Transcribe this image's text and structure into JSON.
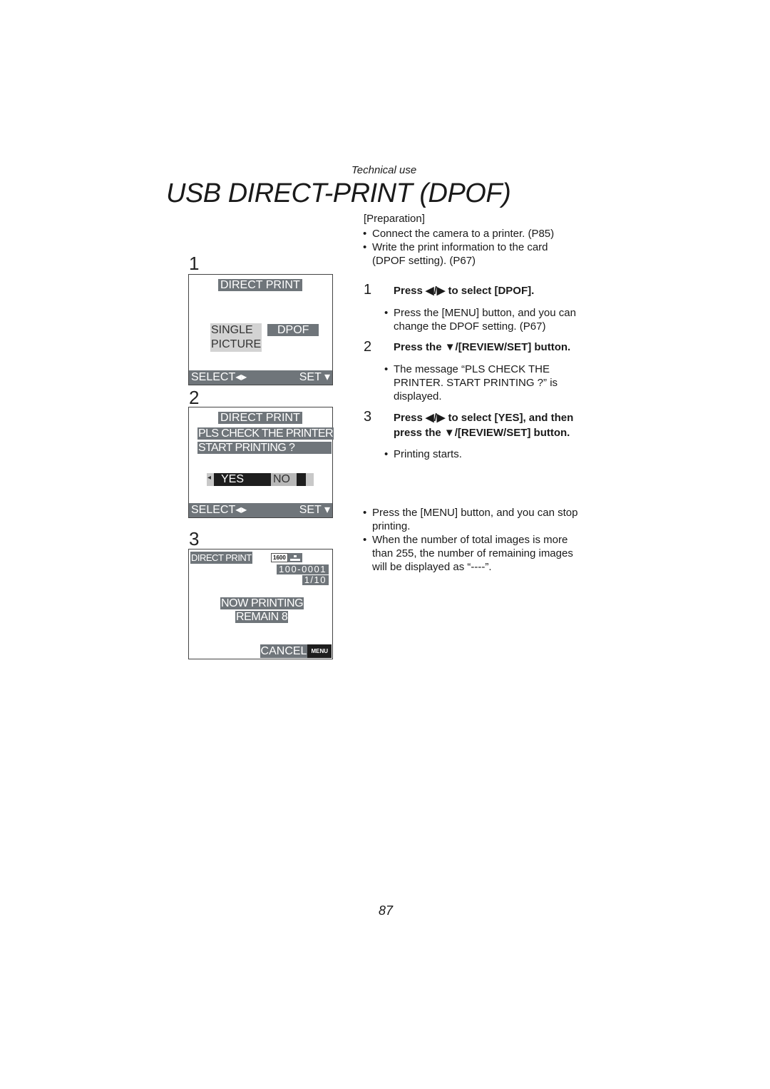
{
  "header": {
    "section": "Technical use",
    "title": "USB DIRECT-PRINT (DPOF)"
  },
  "screens": [
    {
      "number": "1",
      "title": "DIRECT PRINT",
      "option_left": [
        "SINGLE",
        "PICTURE"
      ],
      "option_right": "DPOF",
      "bar_left": "SELECT◂▸",
      "bar_right": "SET ▾"
    },
    {
      "number": "2",
      "title": "DIRECT PRINT",
      "message_line1": "PLS CHECK THE PRINTER",
      "message_line2": "START PRINTING ?",
      "arrow": "◂",
      "yes": "YES",
      "no": "NO",
      "bar_left": "SELECT◂▸",
      "bar_right": "SET ▾"
    },
    {
      "number": "3",
      "title": "DIRECT PRINT",
      "resolution": "1600",
      "quality_icon": "quality-icon",
      "file_number": "100-0001",
      "counter": "1/10",
      "status_line1": "NOW PRINTING",
      "status_line2": "REMAIN 8",
      "cancel": "CANCEL",
      "menu": "MENU"
    }
  ],
  "preparation": {
    "heading": "[Preparation]",
    "bullets": [
      "Connect the camera to a printer. (P85)",
      "Write the print information to the card",
      "(DPOF setting). (P67)"
    ]
  },
  "steps": [
    {
      "number": "1",
      "text_a": "Press ◀/▶ to select [DPOF].",
      "notes": [
        "Press the [MENU] button, and you can",
        "change the DPOF setting. (P67)"
      ]
    },
    {
      "number": "2",
      "text_a": "Press the ▼/[REVIEW/SET] button.",
      "notes": [
        "The message “PLS CHECK THE",
        "PRINTER. START PRINTING ?” is",
        "displayed."
      ]
    },
    {
      "number": "3",
      "text_a": "Press ◀/▶ to select [YES], and then",
      "text_b": "press the ▼/[REVIEW/SET] button.",
      "notes": [
        "Printing starts."
      ]
    }
  ],
  "footnotes": [
    [
      "Press the [MENU] button, and you can stop",
      "printing."
    ],
    [
      "When the number of total images is more",
      "than 255, the number of remaining images",
      "will be displayed as “----”."
    ]
  ],
  "bullet_char": "•",
  "page_number": "87"
}
